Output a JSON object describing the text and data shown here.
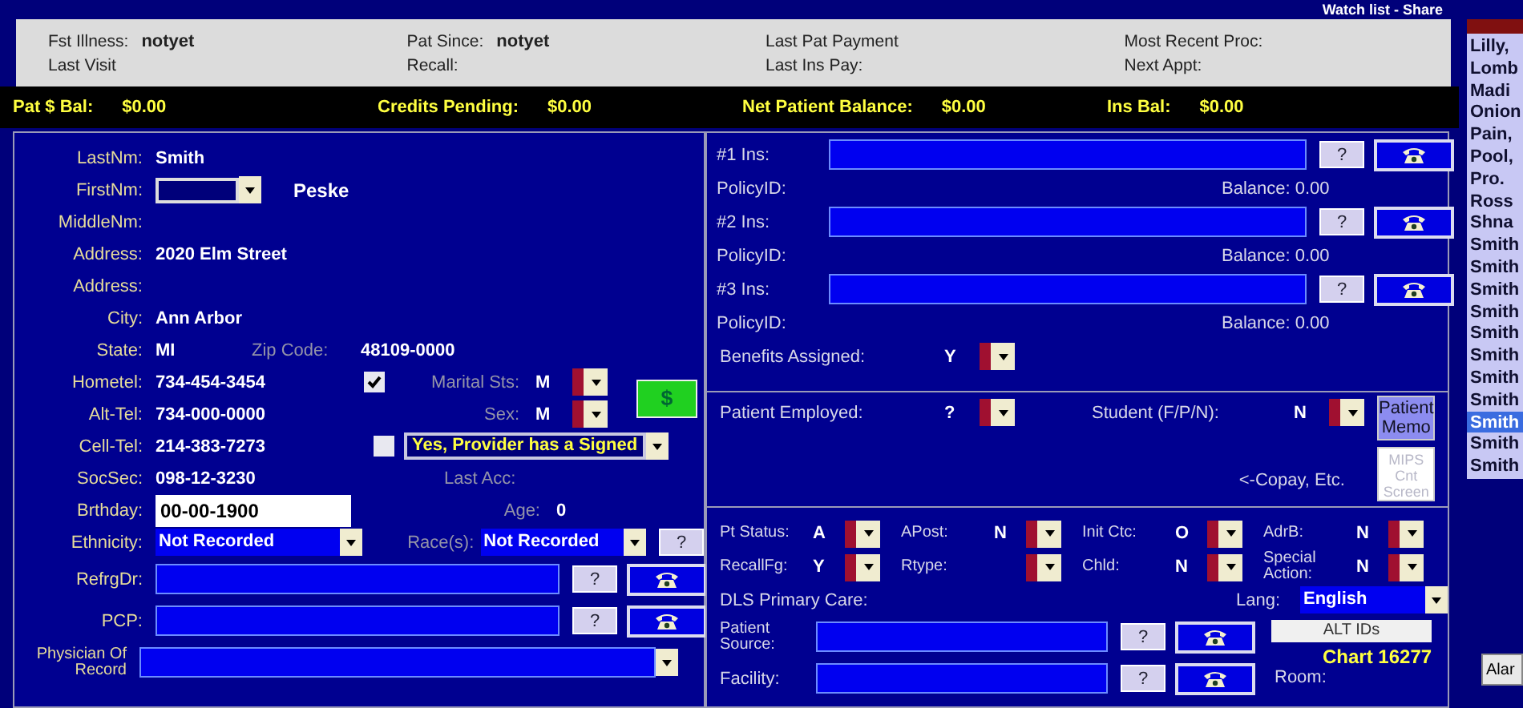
{
  "top_strip": {
    "text": "Watch list - Share"
  },
  "summary": {
    "rows": [
      [
        {
          "label": "Fst Illness:",
          "value": "notyet"
        },
        {
          "label": "Pat Since:",
          "value": "notyet"
        },
        {
          "label": "Last Pat Payment"
        },
        {
          "label": "Most Recent Proc:"
        }
      ],
      [
        {
          "label": "Last Visit"
        },
        {
          "label": "Recall:"
        },
        {
          "label": "Last Ins Pay:"
        },
        {
          "label": "Next Appt:"
        }
      ]
    ]
  },
  "balances": [
    {
      "label": "Pat $ Bal:",
      "value": "$0.00"
    },
    {
      "label": "Credits Pending:",
      "value": "$0.00"
    },
    {
      "label": "Net Patient Balance:",
      "value": "$0.00"
    },
    {
      "label": "Ins Bal:",
      "value": "$0.00"
    }
  ],
  "patient": {
    "last_name": {
      "label": "LastNm:",
      "value": "Smith"
    },
    "first_name": {
      "label": "FirstNm:",
      "value": "Peske"
    },
    "middle_name": {
      "label": "MiddleNm:"
    },
    "address_1": {
      "label": "Address:",
      "value": "2020 Elm Street"
    },
    "address_2": {
      "label": "Address:"
    },
    "city": {
      "label": "City:",
      "value": "Ann Arbor"
    },
    "state": {
      "label": "State:",
      "value": "MI"
    },
    "zip": {
      "label": "Zip Code:",
      "value": "48109-0000"
    },
    "home_tel": {
      "label": "Hometel:",
      "value": "734-454-3454",
      "checked": true
    },
    "marital": {
      "label": "Marital Sts:",
      "value": "M"
    },
    "money_button": {
      "label": "$"
    },
    "alt_tel": {
      "label": "Alt-Tel:",
      "value": "734-000-0000"
    },
    "sex": {
      "label": "Sex:",
      "value": "M"
    },
    "cell_tel": {
      "label": "Cell-Tel:",
      "value": "214-383-7273",
      "checked": false
    },
    "consent": {
      "value": "Yes, Provider has a Signed"
    },
    "ssn": {
      "label": "SocSec:",
      "value": "098-12-3230"
    },
    "last_acc": {
      "label": "Last Acc:"
    },
    "birthday": {
      "label": "Brthday:",
      "value": "00-00-1900"
    },
    "age": {
      "label": "Age:",
      "value": "0"
    },
    "ethnicity": {
      "label": "Ethnicity:",
      "value": "Not Recorded"
    },
    "race": {
      "label": "Race(s):",
      "value": "Not Recorded",
      "help": "?"
    },
    "referring": {
      "label": "RefrgDr:",
      "help": "?"
    },
    "pcp": {
      "label": "PCP:",
      "help": "?"
    },
    "physician": {
      "label": "Physician Of Record"
    }
  },
  "insurance": [
    {
      "label": "#1 Ins:",
      "help": "?",
      "policy_label": "PolicyID:",
      "balance": "Balance: 0.00"
    },
    {
      "label": "#2 Ins:",
      "help": "?",
      "policy_label": "PolicyID:",
      "balance": "Balance: 0.00"
    },
    {
      "label": "#3 Ins:",
      "help": "?",
      "policy_label": "PolicyID:",
      "balance": "Balance: 0.00"
    }
  ],
  "benefits": {
    "label": "Benefits Assigned:",
    "value": "Y"
  },
  "employment": {
    "employed": {
      "label": "Patient Employed:",
      "value": "?"
    },
    "student": {
      "label": "Student (F/P/N):",
      "value": "N"
    },
    "memo_button": {
      "label": "Patient Memo"
    },
    "copay_note": "<-Copay, Etc.",
    "mips_button": {
      "label": "MIPS Cnt Screen",
      "disabled": true
    }
  },
  "status_rows": [
    [
      {
        "label": "Pt Status:",
        "value": "A"
      },
      {
        "label": "APost:",
        "value": "N"
      },
      {
        "label": "Init Ctc:",
        "value": "O"
      },
      {
        "label": "AdrB:",
        "value": "N"
      }
    ],
    [
      {
        "label": "RecallFg:",
        "value": "Y"
      },
      {
        "label": "Rtype:"
      },
      {
        "label": "Chld:",
        "value": "N"
      },
      {
        "label": "Special Action:",
        "value": "N"
      }
    ]
  ],
  "primary_care": {
    "label": "DLS Primary Care:"
  },
  "language": {
    "label": "Lang:",
    "value": "English"
  },
  "patient_source": {
    "label": "Patient Source:",
    "help": "?"
  },
  "alt_ids_button": {
    "label": "ALT IDs"
  },
  "chart": "Chart 16277",
  "facility": {
    "label": "Facility:",
    "help": "?"
  },
  "room": {
    "label": "Room:"
  },
  "patient_list": [
    {
      "name": "Lilly,",
      "selected": false
    },
    {
      "name": "Lomb",
      "selected": false
    },
    {
      "name": "Madi",
      "selected": false
    },
    {
      "name": "Onion",
      "selected": false
    },
    {
      "name": "Pain,",
      "selected": false
    },
    {
      "name": "Pool,",
      "selected": false
    },
    {
      "name": "Pro.",
      "selected": false
    },
    {
      "name": "Ross",
      "selected": false
    },
    {
      "name": "Shna",
      "selected": false
    },
    {
      "name": "Smith",
      "selected": false
    },
    {
      "name": "Smith",
      "selected": false
    },
    {
      "name": "Smith",
      "selected": false
    },
    {
      "name": "Smith",
      "selected": false
    },
    {
      "name": "Smith",
      "selected": false
    },
    {
      "name": "Smith",
      "selected": false
    },
    {
      "name": "Smith",
      "selected": false
    },
    {
      "name": "Smith",
      "selected": false
    },
    {
      "name": "Smith",
      "selected": true
    },
    {
      "name": "Smith",
      "selected": false
    },
    {
      "name": "Smith",
      "selected": false
    }
  ],
  "side_button": {
    "label": "Alar"
  }
}
